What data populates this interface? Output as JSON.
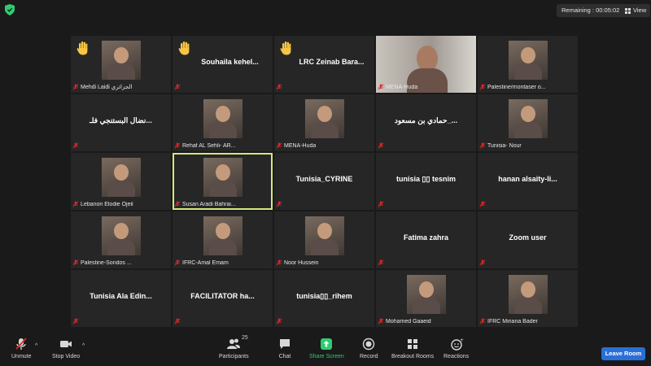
{
  "topbar": {
    "remaining": "Remaining : 00:05:02",
    "view_label": "View"
  },
  "tiles": [
    {
      "type": "video",
      "name": "Mehdi Laidi الجزائري",
      "hand": true
    },
    {
      "type": "text",
      "big": "Souhaila kehel...",
      "hand": true
    },
    {
      "type": "text",
      "big": "LRC Zeinab Bara...",
      "hand": true
    },
    {
      "type": "video-wide",
      "name": "MENA-Huda"
    },
    {
      "type": "video",
      "name": "Palestine/montaser o..."
    },
    {
      "type": "text",
      "big": "نضال البستنجي فلـ..."
    },
    {
      "type": "video",
      "name": "Rehaf AL Sehli- AR..."
    },
    {
      "type": "video",
      "name": "MENA-Huda"
    },
    {
      "type": "text",
      "big": "حمادي بن مسعود_..."
    },
    {
      "type": "video",
      "name": "Tunisia- Nour"
    },
    {
      "type": "video",
      "name": "Lebanon Elodie Ojeil"
    },
    {
      "type": "video",
      "name": "Susan Aradi Bahrai...",
      "active": true
    },
    {
      "type": "text",
      "big": "Tunisia_CYRINE"
    },
    {
      "type": "text",
      "big": "tunisia ▯▯ tesnim"
    },
    {
      "type": "text",
      "big": "hanan alsaity-li..."
    },
    {
      "type": "video",
      "name": "Palestine-Sondos ..."
    },
    {
      "type": "video",
      "name": "IFRC-Amal Emam"
    },
    {
      "type": "video",
      "name": "Noor Hussein"
    },
    {
      "type": "text",
      "big": "Fatima zahra"
    },
    {
      "type": "text",
      "big": "Zoom user"
    },
    {
      "type": "text",
      "big": "Tunisia Ala Edin..."
    },
    {
      "type": "text",
      "big": "FACILITATOR ha..."
    },
    {
      "type": "text",
      "big": "tunisia▯▯_rihem"
    },
    {
      "type": "video",
      "name": "Mohamed Gaaeid"
    },
    {
      "type": "video",
      "name": "IFRC Miriana Bader"
    }
  ],
  "toolbar": {
    "unmute": "Unmute",
    "stop_video": "Stop Video",
    "participants": "Participants",
    "participants_count": "25",
    "chat": "Chat",
    "share_screen": "Share Screen",
    "record": "Record",
    "breakout_rooms": "Breakout Rooms",
    "reactions": "Reactions",
    "leave_room": "Leave Room"
  },
  "colors": {
    "share_green": "#2ecc71",
    "leave_blue": "#2a6fd6",
    "active_border": "#d4e87a",
    "mute_red": "#e02828",
    "hand_yellow": "#f6c543"
  }
}
